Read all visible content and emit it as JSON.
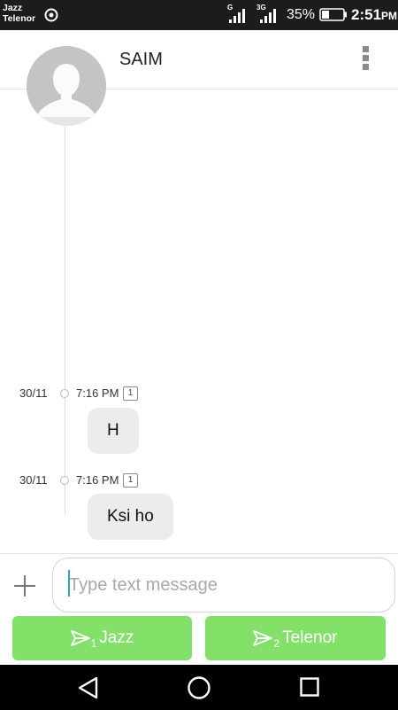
{
  "status_bar": {
    "carrier_1": "Jazz",
    "carrier_2": "Telenor",
    "net_1": "G",
    "net_2": "3G",
    "battery": "35%",
    "time": "2:51",
    "time_suffix": "PM"
  },
  "header": {
    "contact_name": "SAIM",
    "menu_icon": "more-vert-icon"
  },
  "messages": [
    {
      "date": "30/11",
      "time": "7:16 PM",
      "sim": "1",
      "text": "H"
    },
    {
      "date": "30/11",
      "time": "7:16 PM",
      "sim": "1",
      "text": "Ksi ho"
    }
  ],
  "composer": {
    "placeholder": "Type text message",
    "add_icon": "plus-icon",
    "send_1": {
      "sim": "1",
      "label": "Jazz"
    },
    "send_2": {
      "sim": "2",
      "label": "Telenor"
    }
  },
  "colors": {
    "send_button": "#83e16a",
    "bubble": "#ececec",
    "cursor": "#29a8c4"
  }
}
